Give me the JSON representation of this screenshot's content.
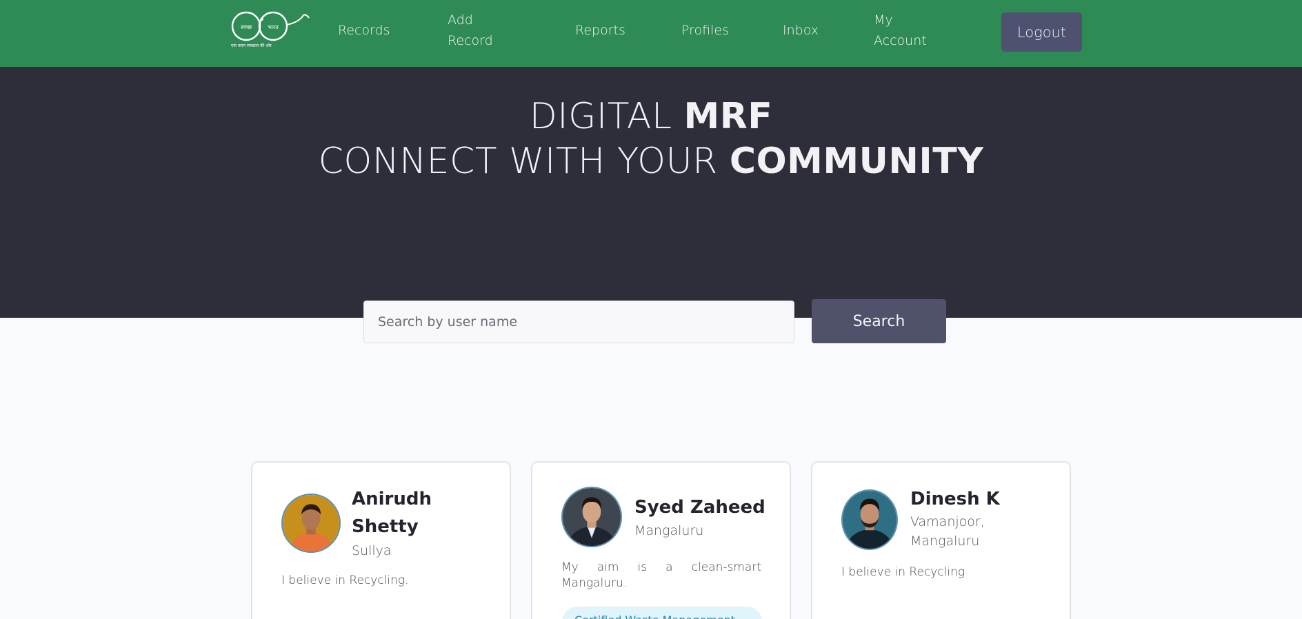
{
  "nav": {
    "logo": {
      "text_left": "स्वच्छ",
      "text_right": "भारत",
      "tagline": "एक कदम स्वच्छता की ओर"
    },
    "items": [
      "Records",
      "Add Record",
      "Reports",
      "Profiles",
      "Inbox",
      "My Account"
    ],
    "logout": "Logout"
  },
  "hero": {
    "line1_light": "DIGITAL ",
    "line1_bold": "MRF",
    "line2_light": "CONNECT WITH YOUR ",
    "line2_bold": "COMMUNITY",
    "search_placeholder": "Search by user name",
    "search_button": "Search"
  },
  "profiles": [
    {
      "name": "Anirudh Shetty",
      "location": "Sullya",
      "bio": "I believe in Recycling.",
      "badge": ""
    },
    {
      "name": "Syed Zaheed",
      "location": "Mangaluru",
      "bio": "My aim is a clean-smart Mangaluru.",
      "badge": "Certified Waste Management"
    },
    {
      "name": "Dinesh K",
      "location": "Vamanjoor, Mangaluru",
      "bio": "I believe in Recycling",
      "badge": ""
    }
  ],
  "colors": {
    "nav_green": "#2f8b56",
    "hero_dark": "#2e2e3a",
    "button_slate": "#50526c",
    "badge_bg": "#dff4fb"
  }
}
